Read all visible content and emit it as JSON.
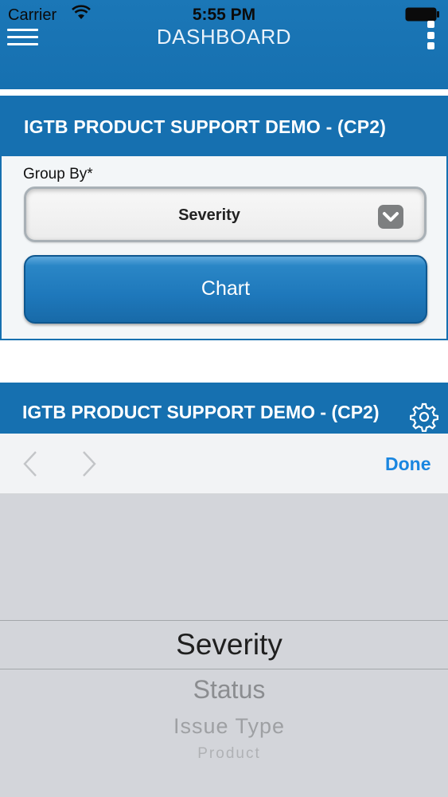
{
  "status_bar": {
    "carrier": "Carrier",
    "time": "5:55 PM"
  },
  "header": {
    "title": "DASHBOARD",
    "menu_icon": "hamburger-menu-icon",
    "more_icon": "more-vertical-icon"
  },
  "panel1": {
    "title": "IGTB PRODUCT SUPPORT DEMO - (CP2)",
    "group_by_label": "Group By*",
    "group_by_value": "Severity",
    "chart_button": "Chart"
  },
  "panel2": {
    "title": "IGTB PRODUCT SUPPORT DEMO - (CP2)",
    "settings_icon": "gear-icon"
  },
  "picker_toolbar": {
    "done_label": "Done"
  },
  "picker": {
    "options": [
      "Severity",
      "Status",
      "Issue Type",
      "Product"
    ],
    "selected": "Severity"
  },
  "colors": {
    "brand_blue": "#1670b0",
    "done_blue": "#1a86e0"
  }
}
